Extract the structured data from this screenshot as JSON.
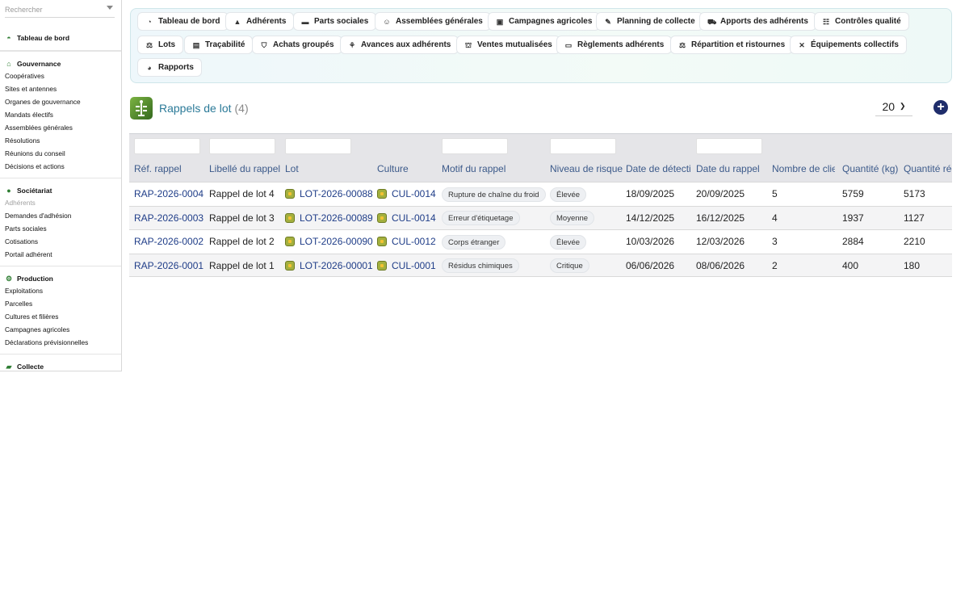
{
  "search": {
    "placeholder": "Rechercher"
  },
  "sidebar": {
    "dashboard": "Tableau de bord",
    "sections": [
      {
        "title": "Gouvernance",
        "icon": "bank-icon",
        "items": [
          "Coopératives",
          "Sites et antennes",
          "Organes de gouvernance",
          "Mandats électifs",
          "Assemblées générales",
          "Résolutions",
          "Réunions du conseil",
          "Décisions et actions"
        ]
      },
      {
        "title": "Sociétariat",
        "icon": "person-icon",
        "items": [
          "Adhérents",
          "Demandes d'adhésion",
          "Parts sociales",
          "Cotisations",
          "Portail adhérent"
        ]
      },
      {
        "title": "Production",
        "icon": "tractor-icon",
        "items": [
          "Exploitations",
          "Parcelles",
          "Cultures et filières",
          "Campagnes agricoles",
          "Déclarations prévisionnelles"
        ]
      },
      {
        "title": "Collecte",
        "icon": "truck-icon",
        "items": []
      }
    ]
  },
  "toolbar": {
    "buttons": [
      "Tableau de bord",
      "Adhérents",
      "Parts sociales",
      "Assemblées générales",
      "Campagnes agricoles",
      "Planning de collecte",
      "Apports des adhérents",
      "Contrôles qualité",
      "Lots",
      "Traçabilité",
      "Achats groupés",
      "Avances aux adhérents",
      "Ventes mutualisées",
      "Règlements adhérents",
      "Répartition et ristournes",
      "Équipements collectifs",
      "Rapports"
    ]
  },
  "page": {
    "title": "Rappels de lot",
    "count": "(4)",
    "page_size": "20"
  },
  "table": {
    "headers": [
      "Réf. rappel",
      "Libellé du rappel",
      "Lot",
      "Culture",
      "Motif du rappel",
      "Niveau de risque",
      "Date de détection",
      "Date du rappel",
      "Nombre de clients",
      "Quantité (kg)",
      "Quantité récupérée"
    ],
    "rows": [
      {
        "ref": "RAP-2026-0004",
        "label": "Rappel de lot 4",
        "lot": "LOT-2026-00088",
        "culture": "CUL-0014",
        "motif": "Rupture de chaîne du froid",
        "risque": "Élevée",
        "detection": "18/09/2025",
        "rappel": "20/09/2025",
        "clients": "5",
        "qte": "5759",
        "recup": "5173"
      },
      {
        "ref": "RAP-2026-0003",
        "label": "Rappel de lot 3",
        "lot": "LOT-2026-00089",
        "culture": "CUL-0014",
        "motif": "Erreur d'étiquetage",
        "risque": "Moyenne",
        "detection": "14/12/2025",
        "rappel": "16/12/2025",
        "clients": "4",
        "qte": "1937",
        "recup": "1127"
      },
      {
        "ref": "RAP-2026-0002",
        "label": "Rappel de lot 2",
        "lot": "LOT-2026-00090",
        "culture": "CUL-0012",
        "motif": "Corps étranger",
        "risque": "Élevée",
        "detection": "10/03/2026",
        "rappel": "12/03/2026",
        "clients": "3",
        "qte": "2884",
        "recup": "2210"
      },
      {
        "ref": "RAP-2026-0001",
        "label": "Rappel de lot 1",
        "lot": "LOT-2026-00001",
        "culture": "CUL-0001",
        "motif": "Résidus chimiques",
        "risque": "Critique",
        "detection": "06/06/2026",
        "rappel": "08/06/2026",
        "clients": "2",
        "qte": "400",
        "recup": "180"
      }
    ]
  }
}
